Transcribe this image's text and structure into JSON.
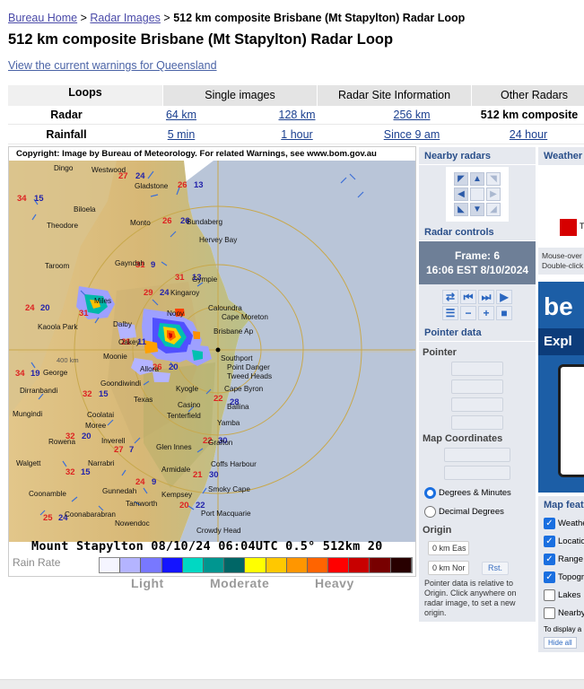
{
  "breadcrumb": {
    "items": [
      "Bureau Home",
      "Radar Images"
    ],
    "separator": ">",
    "current": "512 km composite Brisbane (Mt Stapylton) Radar Loop"
  },
  "page": {
    "title": "512 km composite Brisbane (Mt Stapylton) Radar Loop",
    "warnings_link": "View the current warnings for Queensland"
  },
  "tabs": [
    {
      "label": "Loops",
      "active": true
    },
    {
      "label": "Single images",
      "active": false
    },
    {
      "label": "Radar Site Information",
      "active": false
    },
    {
      "label": "Other Radars",
      "active": false
    }
  ],
  "products": {
    "radar": {
      "label": "Radar",
      "options": [
        "64 km",
        "128 km",
        "256 km"
      ],
      "current": "512 km composite"
    },
    "rainfall": {
      "label": "Rainfall",
      "options": [
        "5 min",
        "1 hour",
        "Since 9 am",
        "24 hour"
      ]
    }
  },
  "map": {
    "copyright": "Copyright: Image by Bureau of Meteorology. For related Warnings, see www.bom.gov.au",
    "stamp": "Mount Stapylton 08/10/24 06:04UTC 0.5° 512km 20",
    "range_label": "400 km",
    "places": [
      "Dingo",
      "Westwood",
      "Gladstone",
      "Biloela",
      "Theodore",
      "Monto",
      "Bundaberg",
      "Hervey Bay",
      "Taroom",
      "Gayndah",
      "Gympie",
      "Miles",
      "Nooy",
      "Caloundra",
      "Cape Moreton",
      "Kingaroy",
      "Kaoola Park",
      "Dalby",
      "Oakey",
      "Brisbane Ap",
      "Moonie",
      "Allora",
      "Southport",
      "Point Danger",
      "Tweed Heads",
      "Goondiwindi",
      "Kyogle",
      "Cape Byron",
      "Dirranbandi",
      "Texas",
      "Casino",
      "Ballina",
      "Mungindi",
      "Moree",
      "Coolatai",
      "Tenterfield",
      "Yamba",
      "Rowena",
      "Inverell",
      "Glen Innes",
      "Grafton",
      "Walgett",
      "Narrabri",
      "Armidale",
      "Coffs Harbour",
      "Gunnedah",
      "Kempsey",
      "Smoky Cape",
      "Coonamble",
      "Tamworth",
      "Port Macquarie",
      "Coonabarabran",
      "Nowendoc",
      "Crowdy Head",
      "George"
    ]
  },
  "legend": {
    "rain_rate": "Rain Rate",
    "light": "Light",
    "moderate": "Moderate",
    "heavy": "Heavy",
    "colors": [
      "#f5f5ff",
      "#b4b4ff",
      "#7878ff",
      "#1414ff",
      "#00d8c3",
      "#009690",
      "#006666",
      "#ffff00",
      "#ffc800",
      "#ff9600",
      "#ff6400",
      "#ff0000",
      "#c80000",
      "#780000",
      "#280000"
    ]
  },
  "panel": {
    "nearby_title": "Nearby radars",
    "controls_title": "Radar controls",
    "frame_label": "Frame: 6",
    "frame_time": "16:06 EST 8/10/2024",
    "pointer_title": "Pointer data",
    "pointer_label": "Pointer",
    "coords_label": "Map Coordinates",
    "deg_min": "Degrees & Minutes",
    "dec_deg": "Decimal Degrees",
    "origin_label": "Origin",
    "origin_east": "0 km Eas",
    "origin_north": "0 km Nor",
    "reset": "Rst.",
    "note": "Pointer data is relative to Origin. Click anywhere on radar image, to set a new origin."
  },
  "right": {
    "weather_title": "Weather",
    "warn_letter": "T",
    "hint1": "Mouse-over",
    "hint2": "Double-click",
    "ad_title": "be",
    "ad_sub": "Expl",
    "features_title": "Map features",
    "features": [
      {
        "label": "Weather",
        "checked": true
      },
      {
        "label": "Locations",
        "checked": true
      },
      {
        "label": "Range",
        "checked": true
      },
      {
        "label": "Topography",
        "checked": true
      },
      {
        "label": "Lakes",
        "checked": false
      },
      {
        "label": "Nearby",
        "checked": false
      }
    ],
    "to_display": "To display a",
    "hide_all": "Hide all"
  }
}
